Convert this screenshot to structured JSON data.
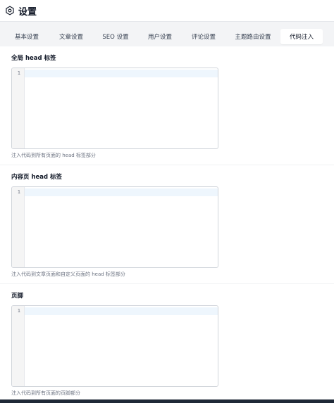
{
  "header": {
    "title": "设置",
    "icon": "gear-icon"
  },
  "tabs": [
    {
      "label": "基本设置",
      "active": false
    },
    {
      "label": "文章设置",
      "active": false
    },
    {
      "label": "SEO 设置",
      "active": false
    },
    {
      "label": "用户设置",
      "active": false
    },
    {
      "label": "评论设置",
      "active": false
    },
    {
      "label": "主题路由设置",
      "active": false
    },
    {
      "label": "代码注入",
      "active": true
    }
  ],
  "sections": [
    {
      "label": "全局 head 标签",
      "line_number": "1",
      "value": "",
      "hint": "注入代码到所有页面的 head 标签部分"
    },
    {
      "label": "内容页 head 标签",
      "line_number": "1",
      "value": "",
      "hint": "注入代码到文章页面和自定义页面的 head 标签部分"
    },
    {
      "label": "页脚",
      "line_number": "1",
      "value": "",
      "hint": "注入代码到所有页面的页脚部分"
    }
  ],
  "colors": {
    "active_line": "#eef6fd",
    "tab_bar_bg": "#f3f4f6"
  }
}
